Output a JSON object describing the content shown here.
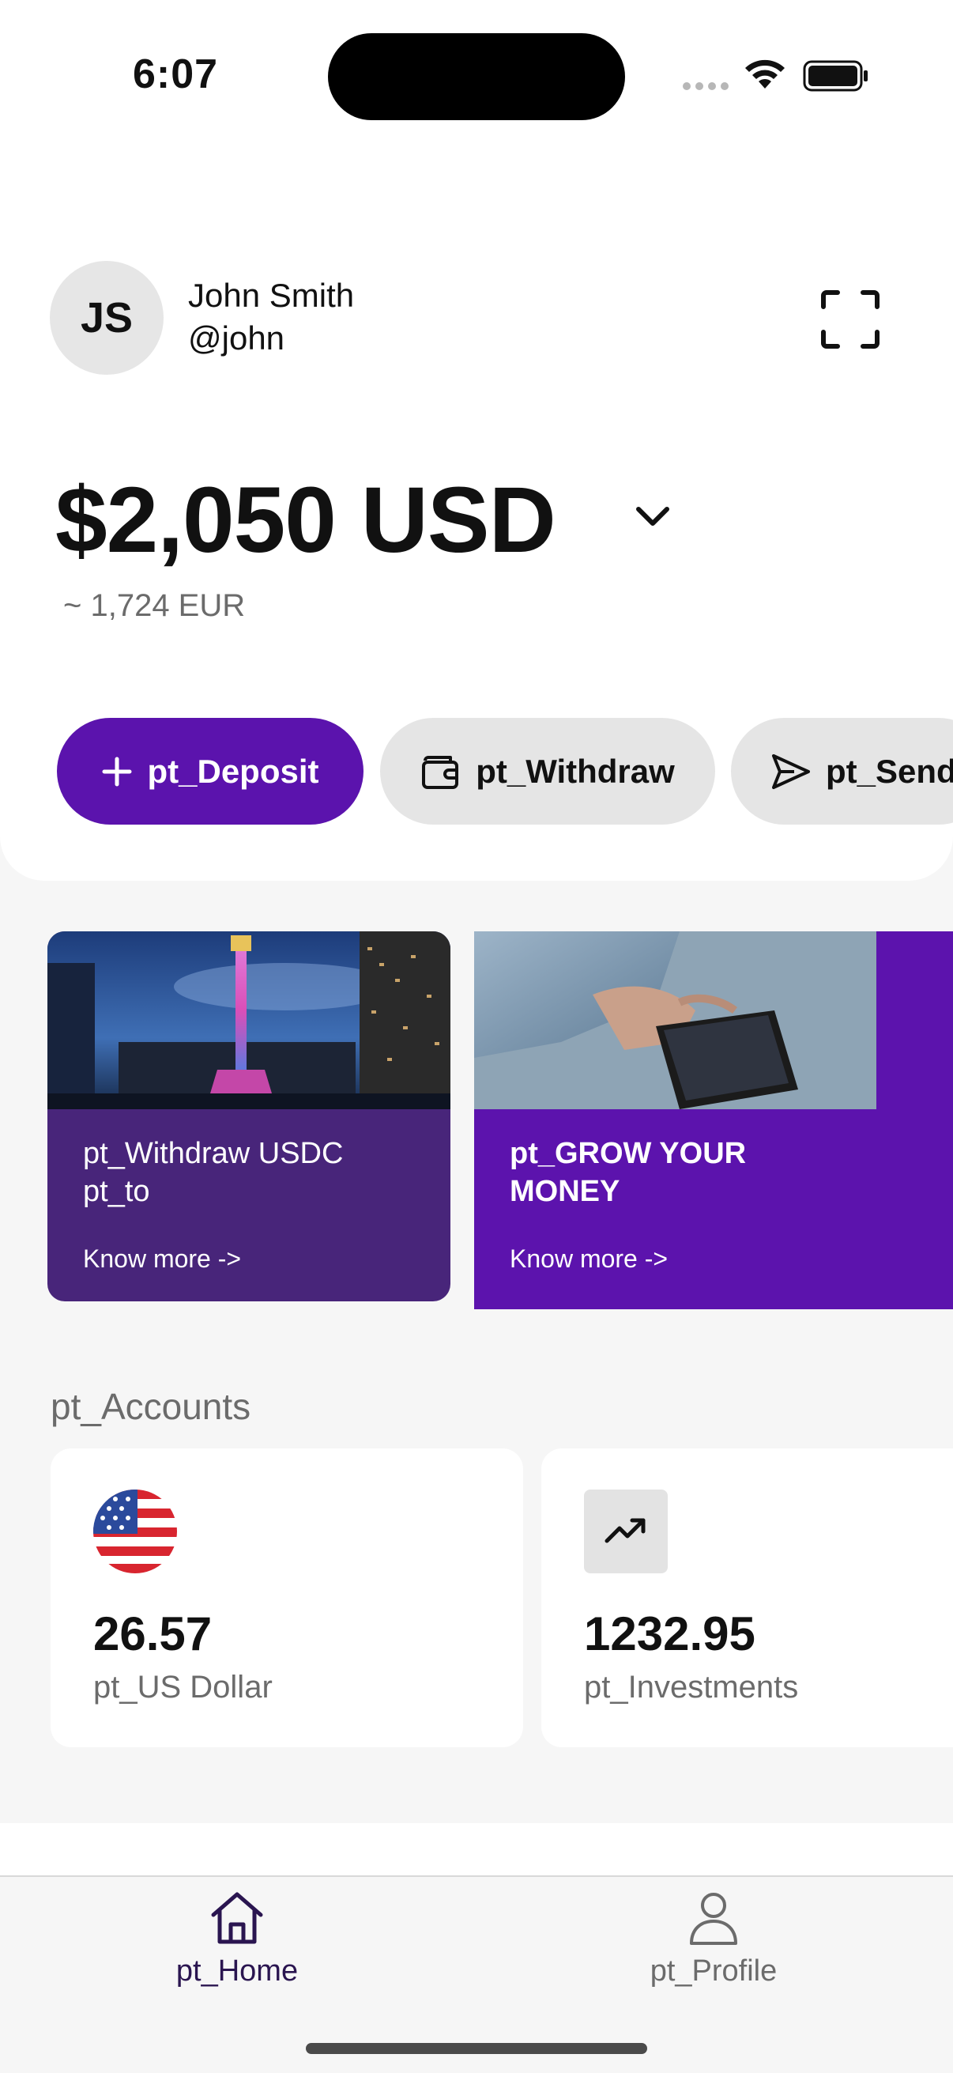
{
  "status_bar": {
    "time": "6:07"
  },
  "user": {
    "initials": "JS",
    "name": "John Smith",
    "handle": "@john"
  },
  "balance": {
    "amount": "$2,050 USD",
    "converted": "~ 1,724 EUR"
  },
  "actions": {
    "deposit": "pt_Deposit",
    "withdraw": "pt_Withdraw",
    "send": "pt_Send"
  },
  "promos": [
    {
      "title_line1": "pt_Withdraw USDC",
      "title_line2": "pt_to",
      "link": "Know more ->"
    },
    {
      "title_line1": "pt_GROW YOUR",
      "title_line2": "MONEY",
      "link": "Know more ->"
    }
  ],
  "accounts": {
    "title": "pt_Accounts",
    "items": [
      {
        "value": "26.57",
        "label": "pt_US Dollar",
        "icon": "us-flag-icon"
      },
      {
        "value": "1232.95",
        "label": "pt_Investments",
        "icon": "trending-up-icon"
      }
    ]
  },
  "tabs": [
    {
      "label": "pt_Home",
      "icon": "home-icon",
      "active": true
    },
    {
      "label": "pt_Profile",
      "icon": "user-icon",
      "active": false
    }
  ],
  "colors": {
    "accent": "#5b13ad",
    "promo_dark": "#48257a",
    "muted_text": "#6b6b6b"
  }
}
